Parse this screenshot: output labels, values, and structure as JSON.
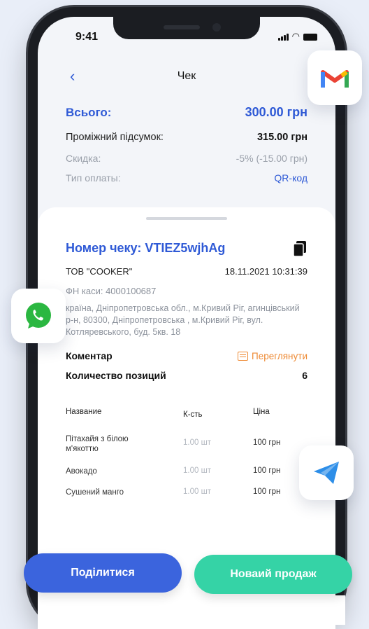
{
  "status_bar": {
    "time": "9:41"
  },
  "nav": {
    "back_icon": "chevron-left-icon",
    "title": "Чек"
  },
  "summary": {
    "total_label": "Всього:",
    "total_value": "300.00 грн",
    "subtotal_label": "Проміжний підсумок:",
    "subtotal_value": "315.00 грн",
    "discount_label": "Скидка:",
    "discount_value": "-5% (-15.00 грн)",
    "payment_label": "Тип оплаты:",
    "payment_value": "QR-код"
  },
  "receipt": {
    "number_label": "Номер чеку: VTIEZ5wjhAg",
    "company": "ТОВ \"COOKER\"",
    "datetime": "18.11.2021 10:31:39",
    "fiscal": "ФН каси: 4000100687",
    "address": "країна, Дніпропетровська обл., м.Кривий Ріг, агинцівський р-н, 80300, Дніпропетровська , м.Кривий Ріг, вул. Котляревського, буд. 5кв. 18",
    "comment_label": "Коментар",
    "view_label": "Переглянути",
    "positions_label": "Количество позиций",
    "positions_count": "6"
  },
  "table": {
    "headers": {
      "name": "Название",
      "qty": "К-сть",
      "price": "Ціна"
    },
    "rows": [
      {
        "name": "Пітахайя з білою м'якоттю",
        "qty": "1.00 шт",
        "price": "100 грн"
      },
      {
        "name": "Авокадо",
        "qty": "1.00 шт",
        "price": "100 грн"
      },
      {
        "name": "Сушений манго",
        "qty": "1.00 шт",
        "price": "100 грн"
      }
    ]
  },
  "share_apps": [
    "gmail-icon",
    "whatsapp-icon",
    "telegram-icon"
  ],
  "actions": {
    "share": "Поділитися",
    "new_sale": "Новаий продаж"
  },
  "colors": {
    "accent": "#2f5ad6",
    "share_button": "#3b64dd",
    "new_sale_button": "#35d3a6",
    "link_orange": "#ee8a34"
  }
}
